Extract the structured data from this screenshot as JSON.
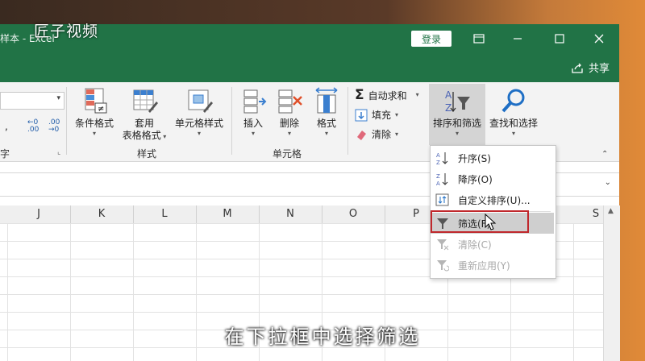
{
  "watermark": "匠子视频",
  "window": {
    "title": "样本 - Excel",
    "login_label": "登录",
    "share_label": "共享"
  },
  "ribbon": {
    "number_group_label": "字",
    "groups": {
      "styles_label": "样式",
      "cells_label": "单元格"
    },
    "buttons": {
      "conditional_format": "条件格式",
      "format_table_1": "套用",
      "format_table_2": "表格格式",
      "cell_style": "单元格样式",
      "insert": "插入",
      "delete": "删除",
      "format": "格式",
      "autosum": "自动求和",
      "fill": "填充",
      "clear": "清除",
      "sort_filter": "排序和筛选",
      "find_select": "查找和选择"
    }
  },
  "columns": [
    "J",
    "K",
    "L",
    "M",
    "N",
    "O",
    "P",
    "S"
  ],
  "dropdown": {
    "items": [
      {
        "label": "升序(S)",
        "disabled": false
      },
      {
        "label": "降序(O)",
        "disabled": false
      },
      {
        "label": "自定义排序(U)...",
        "disabled": false
      },
      {
        "label": "筛选(F)",
        "disabled": false,
        "hover": true
      },
      {
        "label": "清除(C)",
        "disabled": true
      },
      {
        "label": "重新应用(Y)",
        "disabled": true
      }
    ]
  },
  "subtitle": "在下拉框中选择筛选",
  "colors": {
    "excel_green": "#217346",
    "highlight_red": "#c0282c"
  }
}
